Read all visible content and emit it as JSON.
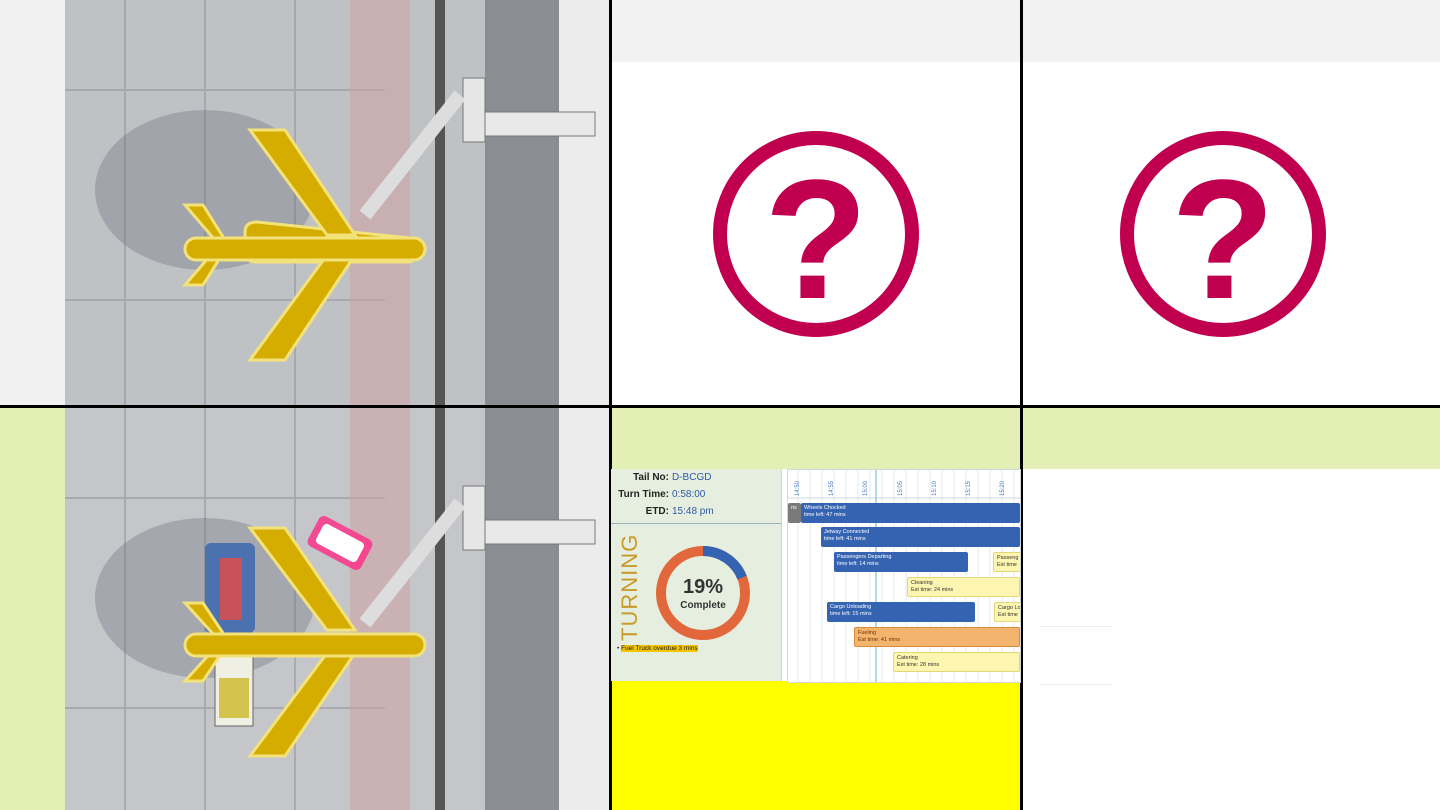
{
  "cells": {
    "top_question_mark": "?",
    "top_right_question_mark": "?"
  },
  "dashboard": {
    "tail_label": "Tail No:",
    "tail_value": "D-BCGD",
    "turn_label": "Turn Time:",
    "turn_value": "0:58:00",
    "etd_label": "ETD:",
    "etd_value": "15:48 pm",
    "status": "TURNING",
    "percent": "19%",
    "complete_label": "Complete",
    "progress_fraction": 0.19,
    "alert": "Fuel Truck overdue 3 mins",
    "time_ticks": [
      "14:50",
      "14:55",
      "15:00",
      "15:05",
      "15:10",
      "15:15",
      "15:20"
    ],
    "tasks": [
      {
        "name": "Wheels Chocked",
        "detail": "time left: 47 mins",
        "style": "blue"
      },
      {
        "name": "Jetway Connected",
        "detail": "time left: 41 mins",
        "style": "blue"
      },
      {
        "name": "Passengers Departing",
        "detail": "time left: 14 mins",
        "style": "blue"
      },
      {
        "name": "Passeng",
        "detail": "Est time",
        "style": "yellow"
      },
      {
        "name": "Cleaning",
        "detail": "Est time: 24 mins",
        "style": "yellow"
      },
      {
        "name": "Cargo Unloading",
        "detail": "time left: 15 mins",
        "style": "blue"
      },
      {
        "name": "Cargo Lo",
        "detail": "Est time",
        "style": "yellow"
      },
      {
        "name": "Fueling",
        "detail": "Est time: 41 mins",
        "style": "orange"
      },
      {
        "name": "Catering",
        "detail": "Est time: 28 mins",
        "style": "yellow"
      }
    ],
    "first_bar_stub": "ns"
  },
  "colors": {
    "question": "#c0004f",
    "plane": "#d4ad00",
    "highlight_green": "#e3efb4",
    "yellow_block": "#ffff00",
    "donut_blue": "#3463b2",
    "donut_orange": "#e2683c"
  }
}
